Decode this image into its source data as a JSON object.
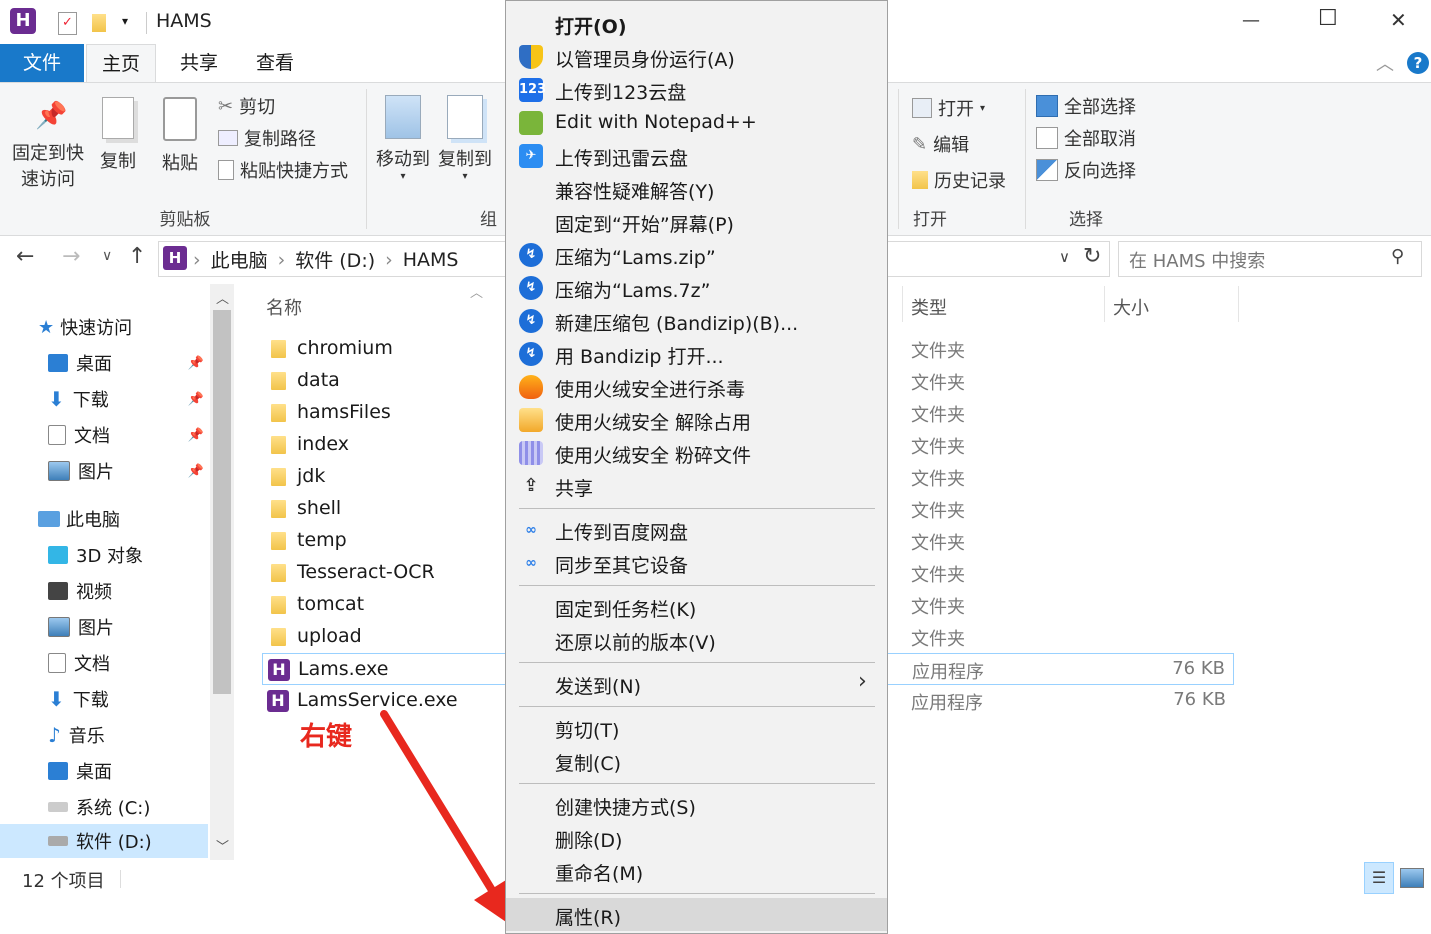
{
  "window": {
    "title": "HAMS",
    "minimize": "—",
    "maximize": "☐",
    "close": "✕"
  },
  "ribbon": {
    "tabs": [
      "文件",
      "主页",
      "共享",
      "查看"
    ],
    "clipboard": {
      "pin_line1": "固定到快",
      "pin_line2": "速访问",
      "copy": "复制",
      "paste": "粘贴",
      "cut": "剪切",
      "copy_path": "复制路径",
      "paste_shortcut": "粘贴快捷方式",
      "group": "剪贴板"
    },
    "organize": {
      "move_to": "移动到",
      "copy_to": "复制到",
      "group": "组"
    },
    "open": {
      "open": "打开",
      "edit": "编辑",
      "history": "历史记录",
      "group": "打开"
    },
    "select": {
      "select_all": "全部选择",
      "select_none": "全部取消",
      "invert": "反向选择",
      "group": "选择"
    }
  },
  "address": {
    "crumbs": [
      "此电脑",
      "软件 (D:)",
      "HAMS"
    ],
    "search_placeholder": "在 HAMS 中搜索"
  },
  "nav": {
    "quick_access": "快速访问",
    "quick_items": [
      "桌面",
      "下载",
      "文档",
      "图片"
    ],
    "this_pc": "此电脑",
    "pc_items": [
      "3D 对象",
      "视频",
      "图片",
      "文档",
      "下载",
      "音乐",
      "桌面",
      "系统 (C:)",
      "软件 (D:)"
    ]
  },
  "columns": {
    "name": "名称",
    "type": "类型",
    "size": "大小"
  },
  "files": [
    {
      "name": "chromium",
      "type": "文件夹",
      "size": ""
    },
    {
      "name": "data",
      "type": "文件夹",
      "size": ""
    },
    {
      "name": "hamsFiles",
      "type": "文件夹",
      "size": ""
    },
    {
      "name": "index",
      "type": "文件夹",
      "size": ""
    },
    {
      "name": "jdk",
      "type": "文件夹",
      "size": ""
    },
    {
      "name": "shell",
      "type": "文件夹",
      "size": ""
    },
    {
      "name": "temp",
      "type": "文件夹",
      "size": ""
    },
    {
      "name": "Tesseract-OCR",
      "type": "文件夹",
      "size": ""
    },
    {
      "name": "tomcat",
      "type": "文件夹",
      "size": ""
    },
    {
      "name": "upload",
      "type": "文件夹",
      "size": ""
    },
    {
      "name": "Lams.exe",
      "type": "应用程序",
      "size": "76 KB"
    },
    {
      "name": "LamsService.exe",
      "type": "应用程序",
      "size": "76 KB"
    }
  ],
  "status": {
    "count": "12 个项目"
  },
  "annotation": {
    "label": "右键",
    "color": "#e8281e"
  },
  "context_menu": {
    "items": [
      {
        "label": "打开(O)",
        "icon": "none",
        "bold": true
      },
      {
        "label": "以管理员身份运行(A)",
        "icon": "shield-icon"
      },
      {
        "label": "上传到123云盘",
        "icon": "cloud-123-icon",
        "icon_text": "123"
      },
      {
        "label": "Edit with Notepad++",
        "icon": "notepad-icon"
      },
      {
        "label": "上传到迅雷云盘",
        "icon": "thunder-icon"
      },
      {
        "label": "兼容性疑难解答(Y)",
        "icon": "none"
      },
      {
        "label": "固定到“开始”屏幕(P)",
        "icon": "none"
      },
      {
        "label": "压缩为“Lams.zip”",
        "icon": "bandizip-icon"
      },
      {
        "label": "压缩为“Lams.7z”",
        "icon": "bandizip-icon"
      },
      {
        "label": "新建压缩包 (Bandizip)(B)...",
        "icon": "bandizip-icon"
      },
      {
        "label": "用 Bandizip 打开...",
        "icon": "bandizip-icon"
      },
      {
        "label": "使用火绒安全进行杀毒",
        "icon": "huorong-icon"
      },
      {
        "label": "使用火绒安全 解除占用",
        "icon": "folder-unlock-icon"
      },
      {
        "label": "使用火绒安全 粉碎文件",
        "icon": "shredder-icon"
      },
      {
        "label": "共享",
        "icon": "share-icon"
      },
      {
        "label": "上传到百度网盘",
        "icon": "baidu-icon"
      },
      {
        "label": "同步至其它设备",
        "icon": "baidu-icon"
      },
      {
        "label": "固定到任务栏(K)",
        "icon": "none"
      },
      {
        "label": "还原以前的版本(V)",
        "icon": "none"
      },
      {
        "label": "发送到(N)",
        "icon": "none",
        "submenu": true
      },
      {
        "label": "剪切(T)",
        "icon": "none"
      },
      {
        "label": "复制(C)",
        "icon": "none"
      },
      {
        "label": "创建快捷方式(S)",
        "icon": "none"
      },
      {
        "label": "删除(D)",
        "icon": "none"
      },
      {
        "label": "重命名(M)",
        "icon": "none"
      },
      {
        "label": "属性(R)",
        "icon": "none",
        "highlighted": true
      }
    ]
  }
}
